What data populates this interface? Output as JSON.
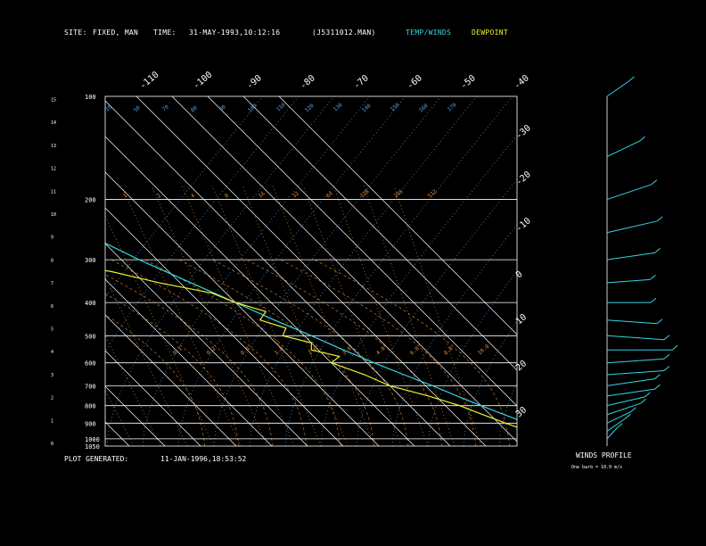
{
  "header": {
    "site_label": "SITE:",
    "site_value": "FIXED, MAN",
    "time_label": "TIME:",
    "time_value": "31-MAY-1993,10:12:16",
    "file_value": "(J5311012.MAN)",
    "temp_label": "TEMP/WINDS",
    "dew_label": "DEWPOINT"
  },
  "footer": {
    "generated_label": "PLOT GENERATED:",
    "generated_value": "11-JAN-1996,18:53:52"
  },
  "wind_panel": {
    "title": "WINDS PROFILE",
    "note": "One barb = 10.0 m/s"
  },
  "colors": {
    "background": "#000000",
    "temp_winds": "#33d6e6",
    "dewpoint": "#f2f230",
    "grid": "#ffffff",
    "mixing_ratio": "#e08a3a",
    "dry_adiabat": "#5aa0e0"
  },
  "chart_data": {
    "type": "line",
    "title": "",
    "pressure_labels": [
      "100",
      "200",
      "300",
      "400",
      "500",
      "600",
      "700",
      "800",
      "900",
      "1000",
      "1050"
    ],
    "pressure_ticks_hpa": [
      100,
      200,
      300,
      400,
      500,
      600,
      700,
      800,
      900,
      1000,
      1050
    ],
    "height_labels": [
      "0",
      "1",
      "2",
      "3",
      "4",
      "5",
      "6",
      "7",
      "8",
      "9",
      "10",
      "11",
      "12",
      "13",
      "14",
      "15"
    ],
    "top_temp_labels": [
      "-110",
      "-100",
      "-90",
      "-80",
      "-70",
      "-60",
      "-50",
      "-40"
    ],
    "right_temp_labels": [
      "-30",
      "-20",
      "-10",
      "0",
      "10",
      "20",
      "30"
    ],
    "right_temp_values": [
      -30,
      -20,
      -10,
      0,
      10,
      20,
      30
    ],
    "skewed_isotherms_c": [
      -140,
      -130,
      -120,
      -110,
      -100,
      -90,
      -80,
      -70,
      -60,
      -50,
      -40,
      -30,
      -20,
      -10,
      0,
      10,
      20,
      30,
      40
    ],
    "dry_adiabat_labels": [
      "10",
      "50",
      "70",
      "80",
      "90",
      "100",
      "110",
      "120",
      "130",
      "140",
      "150",
      "160",
      "170"
    ],
    "mixing_ratio_labels": [
      "1",
      "2",
      "4",
      "8",
      "16",
      "32",
      "64",
      "128",
      "256",
      "512",
      "0.1",
      "0.2",
      "0.4",
      "1.0",
      "2.0",
      "3.0",
      "4.0",
      "6.0",
      "8.0",
      "10.0"
    ],
    "series": [
      {
        "name": "TEMP/WINDS",
        "p": [
          1050,
          1000,
          950,
          900,
          850,
          800,
          750,
          700,
          650,
          600,
          550,
          500,
          450,
          400,
          350,
          300,
          250,
          200,
          175,
          150,
          125,
          100
        ],
        "t": [
          28,
          24,
          22,
          18,
          14,
          10,
          6,
          2,
          -3,
          -8,
          -13,
          -18,
          -24,
          -30,
          -37,
          -45,
          -53,
          -62,
          -68,
          -72,
          -80,
          -86
        ]
      },
      {
        "name": "DEWPOINT",
        "p": [
          1050,
          1000,
          950,
          900,
          850,
          800,
          750,
          700,
          650,
          600,
          575,
          550,
          525,
          500,
          475,
          450,
          425,
          400,
          375,
          350,
          325,
          300,
          275,
          250,
          225,
          200,
          175,
          150,
          125,
          100
        ],
        "t": [
          23,
          21,
          16,
          12,
          8,
          4,
          -2,
          -10,
          -14,
          -20,
          -16,
          -22,
          -20,
          -26,
          -23,
          -28,
          -24,
          -30,
          -34,
          -46,
          -56,
          -72,
          -76,
          -84,
          -86,
          -90,
          -92,
          -96,
          -98,
          -102
        ]
      }
    ],
    "winds": {
      "p": [
        1000,
        950,
        900,
        850,
        800,
        750,
        700,
        650,
        600,
        550,
        500,
        450,
        400,
        350,
        300,
        250,
        200,
        150,
        100
      ],
      "speed_ms": [
        5,
        10,
        10,
        15,
        15,
        20,
        20,
        25,
        25,
        30,
        25,
        20,
        15,
        15,
        20,
        25,
        25,
        20,
        15
      ],
      "direction_deg": [
        200,
        210,
        220,
        230,
        240,
        250,
        250,
        260,
        260,
        270,
        280,
        280,
        270,
        260,
        250,
        240,
        230,
        220,
        210
      ]
    }
  }
}
